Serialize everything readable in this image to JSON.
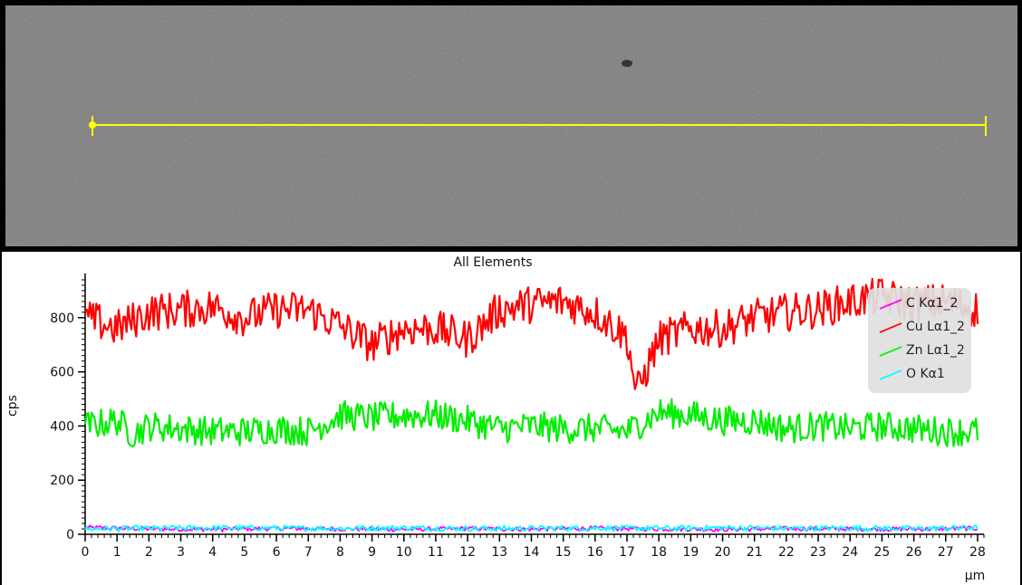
{
  "image_panel": {
    "description": "SEM micrograph with yellow linescan marker",
    "line_color": "#ffff00"
  },
  "chart_data": {
    "type": "line",
    "title": "All Elements",
    "xlabel": "µm",
    "ylabel": "cps",
    "xlim": [
      0,
      28.2
    ],
    "ylim": [
      0,
      950
    ],
    "x_ticks": [
      0,
      1,
      2,
      3,
      4,
      5,
      6,
      7,
      8,
      9,
      10,
      11,
      12,
      13,
      14,
      15,
      16,
      17,
      18,
      19,
      20,
      21,
      22,
      23,
      24,
      25,
      26,
      27,
      28
    ],
    "y_ticks": [
      0,
      200,
      400,
      600,
      800
    ],
    "legend_position": "top-right",
    "series": [
      {
        "name": "C Kα1_2",
        "color": "#ff00ff",
        "x": [
          0,
          2,
          4,
          6,
          8,
          10,
          12,
          14,
          16,
          18,
          20,
          22,
          24,
          26,
          28
        ],
        "values": [
          25,
          20,
          18,
          22,
          20,
          18,
          21,
          19,
          22,
          20,
          18,
          21,
          20,
          19,
          22
        ]
      },
      {
        "name": "Cu Lα1_2",
        "color": "#ff0000",
        "x": [
          0,
          1,
          2,
          3,
          4,
          5,
          6,
          7,
          8,
          9,
          10,
          11,
          12,
          13,
          14,
          15,
          16,
          17,
          17.3,
          18,
          19,
          20,
          21,
          22,
          23,
          24,
          25,
          26,
          27,
          28
        ],
        "values": [
          800,
          760,
          820,
          830,
          840,
          800,
          830,
          830,
          770,
          700,
          760,
          760,
          720,
          830,
          850,
          860,
          820,
          730,
          520,
          720,
          760,
          760,
          800,
          820,
          830,
          860,
          880,
          850,
          860,
          830
        ]
      },
      {
        "name": "Zn Lα1_2",
        "color": "#00ee00",
        "x": [
          0,
          1,
          1.5,
          2,
          3,
          4,
          5,
          6,
          7,
          8,
          9,
          10,
          11,
          12,
          13,
          14,
          15,
          16,
          17,
          18,
          19,
          20,
          21,
          22,
          23,
          24,
          25,
          26,
          27,
          28
        ],
        "values": [
          400,
          420,
          370,
          400,
          390,
          380,
          380,
          390,
          380,
          440,
          430,
          440,
          440,
          420,
          390,
          400,
          390,
          390,
          380,
          450,
          440,
          420,
          420,
          390,
          400,
          390,
          400,
          390,
          380,
          380
        ]
      },
      {
        "name": "O Kα1",
        "color": "#00ffff",
        "x": [
          0,
          2,
          4,
          6,
          8,
          10,
          12,
          14,
          16,
          18,
          20,
          22,
          24,
          26,
          28
        ],
        "values": [
          20,
          22,
          24,
          23,
          22,
          24,
          21,
          22,
          23,
          22,
          24,
          22,
          23,
          21,
          25
        ]
      }
    ]
  }
}
